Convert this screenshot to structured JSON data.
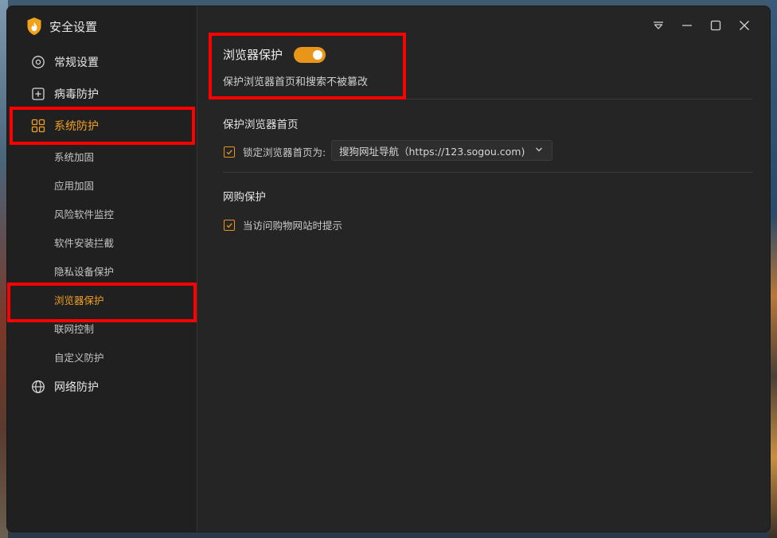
{
  "app": {
    "title": "安全设置"
  },
  "sidebar": {
    "items": [
      {
        "label": "常规设置",
        "icon": "settings-gear-icon"
      },
      {
        "label": "病毒防护",
        "icon": "plus-square-icon"
      },
      {
        "label": "系统防护",
        "icon": "grid-icon",
        "active": true
      },
      {
        "label": "网络防护",
        "icon": "globe-icon"
      }
    ],
    "subitems": [
      {
        "label": "系统加固"
      },
      {
        "label": "应用加固"
      },
      {
        "label": "风险软件监控"
      },
      {
        "label": "软件安装拦截"
      },
      {
        "label": "隐私设备保护"
      },
      {
        "label": "浏览器保护",
        "active": true
      },
      {
        "label": "联网控制"
      },
      {
        "label": "自定义防护"
      }
    ]
  },
  "titlebar": {
    "icons": [
      "dropdown-menu-icon",
      "minimize-icon",
      "maximize-icon",
      "close-icon"
    ]
  },
  "feature": {
    "title": "浏览器保护",
    "enabled": true,
    "description": "保护浏览器首页和搜索不被篡改"
  },
  "sections": {
    "homepage": {
      "title": "保护浏览器首页",
      "lock_label": "锁定浏览器首页为:",
      "lock_checked": true,
      "selected_homepage": "搜狗网址导航（https://123.sogou.com)"
    },
    "shopping": {
      "title": "网购保护",
      "notice_label": "当访问购物网站时提示",
      "notice_checked": true
    }
  },
  "colors": {
    "accent": "#e8961a",
    "active_text": "#f0a020",
    "highlight_box": "#ff0000",
    "window_bg": "#252525",
    "sidebar_bg": "#202020"
  }
}
